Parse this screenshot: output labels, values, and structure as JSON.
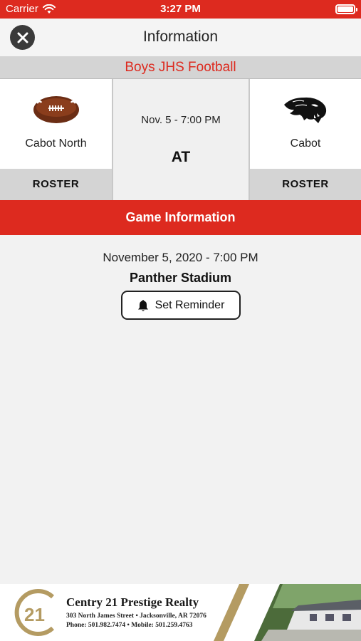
{
  "status_bar": {
    "carrier": "Carrier",
    "time": "3:27 PM"
  },
  "nav": {
    "title": "Information",
    "close_icon": "close-icon"
  },
  "sport": "Boys JHS Football",
  "home_team": {
    "name": "Cabot North",
    "logo_icon": "football-icon",
    "roster_label": "ROSTER"
  },
  "away_team": {
    "name": "Cabot",
    "logo_icon": "panther-icon",
    "roster_label": "ROSTER"
  },
  "matchup": {
    "date_time": "Nov. 5 - 7:00 PM",
    "separator": "AT"
  },
  "game_info": {
    "header": "Game Information",
    "full_date": "November 5, 2020 - 7:00 PM",
    "venue": "Panther Stadium",
    "reminder_label": "Set Reminder",
    "reminder_icon": "bell-icon"
  },
  "ad": {
    "logo_text": "21",
    "title": "Centry 21 Prestige Realty",
    "address": "303 North James Street • Jacksonville, AR 72076",
    "phone": "Phone: 501.982.7474 • Mobile: 501.259.4763"
  },
  "colors": {
    "accent": "#dd2a1f",
    "band_gray": "#d4d4d4",
    "background": "#f2f2f2",
    "ad_gold": "#b49b62"
  }
}
